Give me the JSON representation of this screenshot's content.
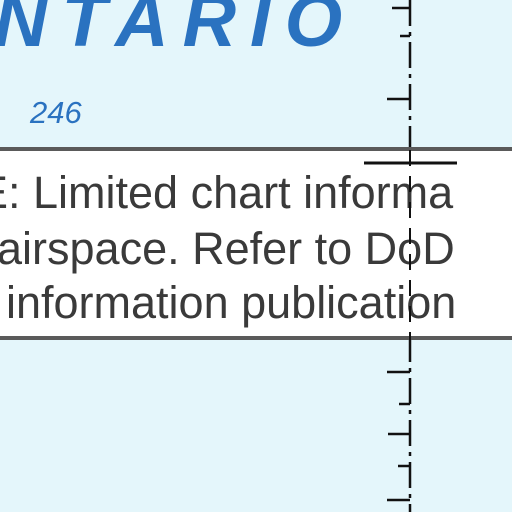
{
  "map": {
    "lake_label": "NTARIO",
    "depth_label": "246",
    "note": {
      "line1": "E: Limited chart informa",
      "line2": "airspace. Refer to DoD",
      "line3": "information publication"
    }
  },
  "colors": {
    "water": "#e4f6fb",
    "label_blue": "#2a72c0",
    "note_text": "#3a3a3a",
    "note_border": "#5a5a5a",
    "grid_line": "#111111"
  }
}
